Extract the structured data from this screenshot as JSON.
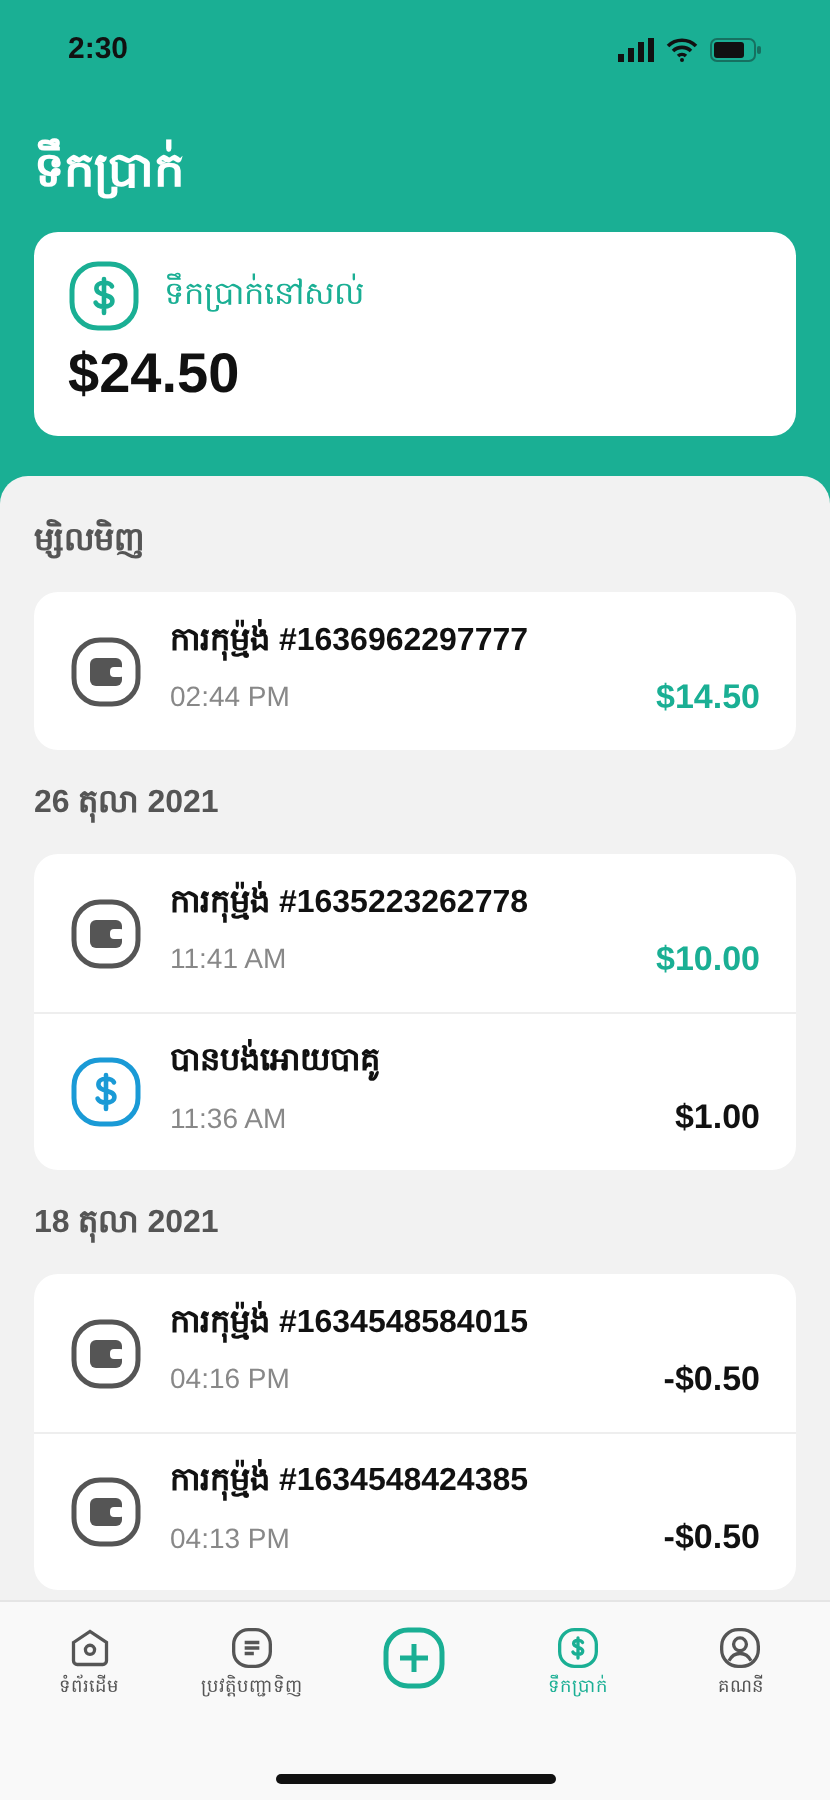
{
  "status_bar": {
    "time": "2:30"
  },
  "header": {
    "title": "ទឹកប្រាក់"
  },
  "balance": {
    "label": "ទឹកប្រាក់នៅសល់",
    "amount": "$24.50"
  },
  "groups": [
    {
      "date": "ម្សិលមិញ",
      "items": [
        {
          "kind": "wallet",
          "title": "ការកុម្ម៉ង់ #1636962297777",
          "time": "02:44 PM",
          "amount": "$14.50",
          "color": "#1aaf94"
        }
      ]
    },
    {
      "date": "26 តុលា 2021",
      "items": [
        {
          "kind": "wallet",
          "title": "ការកុម្ម៉ង់ #1635223262778",
          "time": "11:41 AM",
          "amount": "$10.00",
          "color": "#1aaf94"
        },
        {
          "kind": "payment",
          "title": "បានបង់អោយបាគូ",
          "time": "11:36 AM",
          "amount": "$1.00",
          "color": "#111111"
        }
      ]
    },
    {
      "date": "18 តុលា 2021",
      "items": [
        {
          "kind": "wallet",
          "title": "ការកុម្ម៉ង់ #1634548584015",
          "time": "04:16 PM",
          "amount": "-$0.50",
          "color": "#111111"
        },
        {
          "kind": "wallet",
          "title": "ការកុម្ម៉ង់ #1634548424385",
          "time": "04:13 PM",
          "amount": "-$0.50",
          "color": "#111111"
        }
      ]
    }
  ],
  "tab_bar": [
    {
      "kind": "home",
      "label": "ទំព័រដើម",
      "selected": false
    },
    {
      "kind": "orders",
      "label": "ប្រវត្តិបញ្ជាទិញ",
      "selected": false
    },
    {
      "kind": "add",
      "selected": false
    },
    {
      "kind": "wallet",
      "label": "ទឹកប្រាក់",
      "selected": true
    },
    {
      "kind": "account",
      "label": "គណនី",
      "selected": false
    }
  ]
}
